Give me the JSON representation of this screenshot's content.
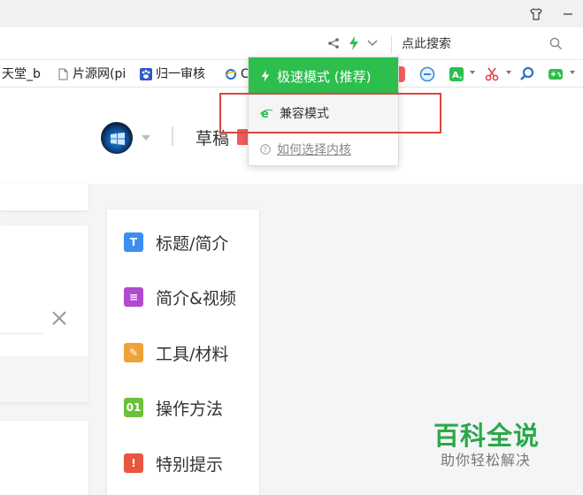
{
  "toolbar": {
    "search_placeholder": "点此搜索"
  },
  "bookmarks": [
    {
      "label": "天堂_b"
    },
    {
      "label": "片源网(pi"
    },
    {
      "label": "归一审核"
    },
    {
      "label": "C"
    }
  ],
  "dropdown": {
    "fast_mode": "极速模式 (推荐)",
    "compat_mode": "兼容模式",
    "help_link": "如何选择内核"
  },
  "header": {
    "draft_label": "草稿"
  },
  "sidenav": {
    "items": [
      {
        "icon_text": "T",
        "label": "标题/简介",
        "color": "#3d8ef0"
      },
      {
        "icon_text": "≡",
        "label": "简介&视频",
        "color": "#b04bd0"
      },
      {
        "icon_text": "✎",
        "label": "工具/材料",
        "color": "#f0a23a"
      },
      {
        "icon_text": "01",
        "label": "操作方法",
        "color": "#6ac23a"
      },
      {
        "icon_text": "!",
        "label": "特别提示",
        "color": "#e8563e"
      }
    ]
  },
  "watermark": {
    "title": "百科全说",
    "subtitle": "助你轻松解决"
  },
  "colors": {
    "accent_green": "#2dbe4e",
    "highlight_red": "#d9463d"
  }
}
